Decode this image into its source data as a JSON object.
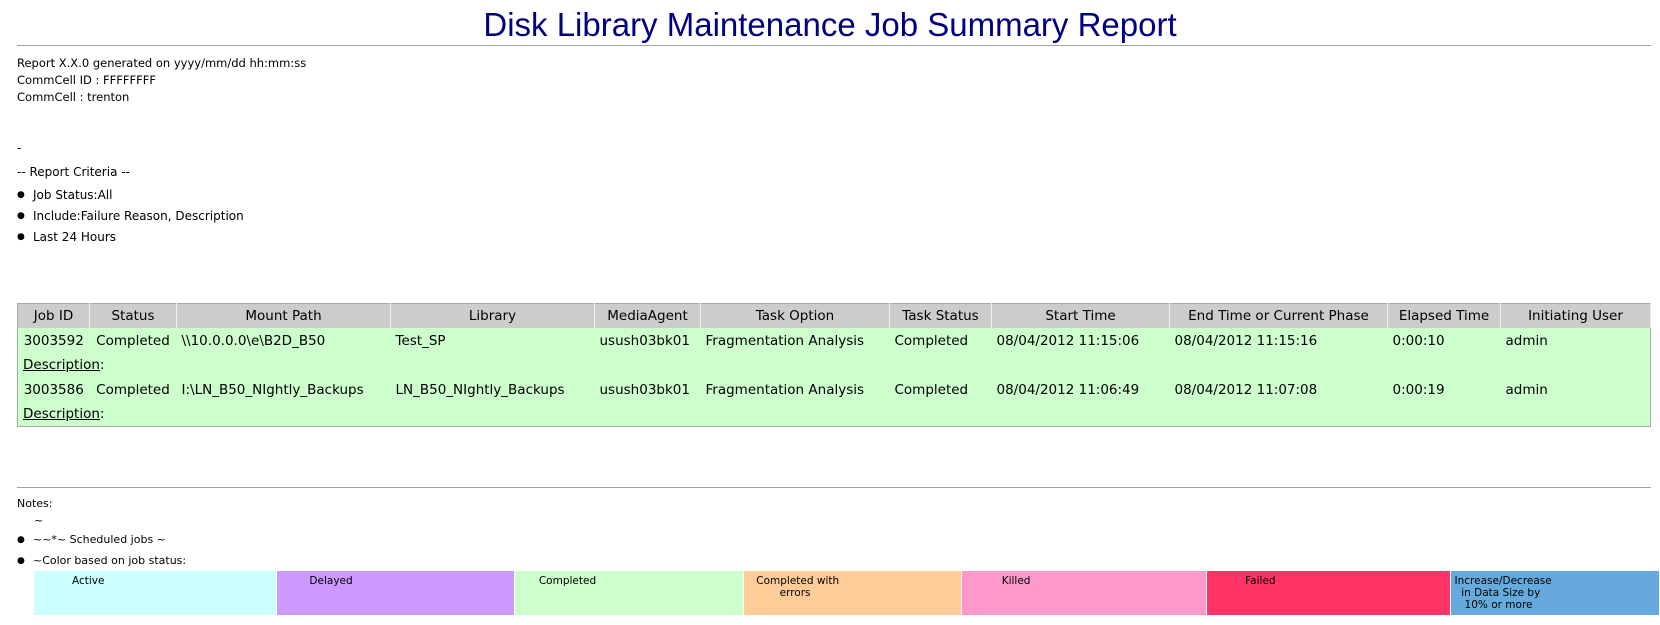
{
  "report": {
    "title": "Disk Library Maintenance Job Summary Report",
    "generated": "Report X.X.0 generated on yyyy/mm/dd hh:mm:ss",
    "commcell_id": "CommCell ID : FFFFFFFF",
    "commcell": "CommCell : trenton",
    "dash": "-",
    "criteria_heading": "-- Report Criteria --",
    "criteria": [
      "Job Status:All",
      "Include:Failure Reason, Description",
      "Last 24 Hours"
    ]
  },
  "table": {
    "headers": [
      "Job ID",
      "Status",
      "Mount Path",
      "Library",
      "MediaAgent",
      "Task Option",
      "Task Status",
      "Start Time",
      "End Time or Current Phase",
      "Elapsed Time",
      "Initiating User"
    ],
    "description_label": "Description",
    "description_colon": ":",
    "rows": [
      {
        "job_id": "3003592",
        "status": "Completed",
        "mount_path": "\\\\10.0.0.0\\e\\B2D_B50",
        "library": "Test_SP",
        "media_agent": "usush03bk01",
        "task_option": "Fragmentation Analysis",
        "task_status": "Completed",
        "start_time": "08/04/2012 11:15:06",
        "end_time": "08/04/2012 11:15:16",
        "elapsed": "0:00:10",
        "user": "admin"
      },
      {
        "job_id": "3003586",
        "status": "Completed",
        "mount_path": "I:\\LN_B50_NIghtly_Backups",
        "library": "LN_B50_NIghtly_Backups",
        "media_agent": "usush03bk01",
        "task_option": "Fragmentation Analysis",
        "task_status": "Completed",
        "start_time": "08/04/2012 11:06:49",
        "end_time": "08/04/2012 11:07:08",
        "elapsed": "0:00:19",
        "user": "admin"
      }
    ]
  },
  "notes": {
    "label": "Notes:",
    "tilde": "~",
    "items": [
      "~~*~ Scheduled jobs ~",
      "~Color based on job status:"
    ]
  },
  "legend": {
    "active": "Active",
    "delayed": "Delayed",
    "completed": "Completed",
    "completed_errors_1": "Completed with",
    "completed_errors_2": "       errors",
    "killed": "Killed",
    "failed": "Failed",
    "incdec_1": "Increase/Decrease",
    "incdec_2": "  in Data Size by",
    "incdec_3": "   10% or more",
    "colors": {
      "active": "#ccffff",
      "delayed": "#cc99ff",
      "completed": "#ccffcc",
      "completed_errors": "#ffcc99",
      "killed": "#ff99cc",
      "failed": "#ff3366",
      "incdec": "#66aadd"
    }
  }
}
